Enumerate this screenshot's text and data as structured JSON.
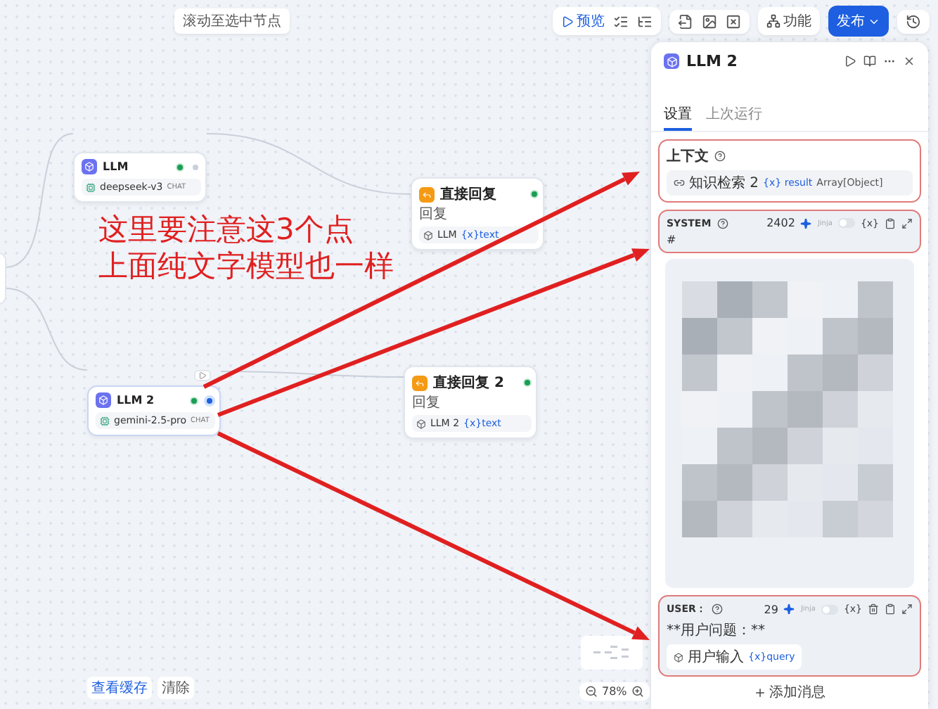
{
  "canvas_hint": "滚动至选中节点",
  "toolbar": {
    "preview": "预览",
    "features": "功能",
    "publish": "发布"
  },
  "nodes": [
    {
      "kind": "llm",
      "title": "LLM",
      "model": "deepseek-v3",
      "mode": "CHAT",
      "selected": false
    },
    {
      "kind": "answer",
      "title": "直接回复",
      "field": "回复",
      "source": "LLM",
      "var_mark": "{x}",
      "var": "text"
    },
    {
      "kind": "llm",
      "title": "LLM 2",
      "model": "gemini-2.5-pro",
      "mode": "CHAT",
      "selected": true
    },
    {
      "kind": "answer",
      "title": "直接回复 2",
      "field": "回复",
      "source": "LLM 2",
      "var_mark": "{x}",
      "var": "text"
    }
  ],
  "annotation": {
    "lines": [
      "这里要注意这3个点",
      "上面纯文字模型也一样"
    ]
  },
  "panel": {
    "title": "LLM 2",
    "tabs": [
      {
        "label": "设置",
        "selected": true
      },
      {
        "label": "上次运行",
        "selected": false
      }
    ],
    "context": {
      "label": "上下文",
      "source": "知识检索 2",
      "var_mark": "{x}",
      "var": "result",
      "type": "Array[Object]",
      "highlighted": true
    },
    "messages": [
      {
        "role": "SYSTEM",
        "count": "2402",
        "jinja_label": "Jinja",
        "jinja": false,
        "insert_var": "{x}",
        "highlighted": true,
        "text": "#"
      },
      {
        "role": "USER：",
        "count": "29",
        "jinja_label": "Jinja",
        "jinja": false,
        "insert_var": "{x}",
        "highlighted": true,
        "text": "**用户问题：**",
        "source": "用户输入",
        "var_mark": "{x}",
        "var": "query"
      }
    ],
    "add_message": "添加消息"
  },
  "cache": {
    "view": "查看缓存",
    "clear": "清除"
  },
  "zoom": "78%"
}
